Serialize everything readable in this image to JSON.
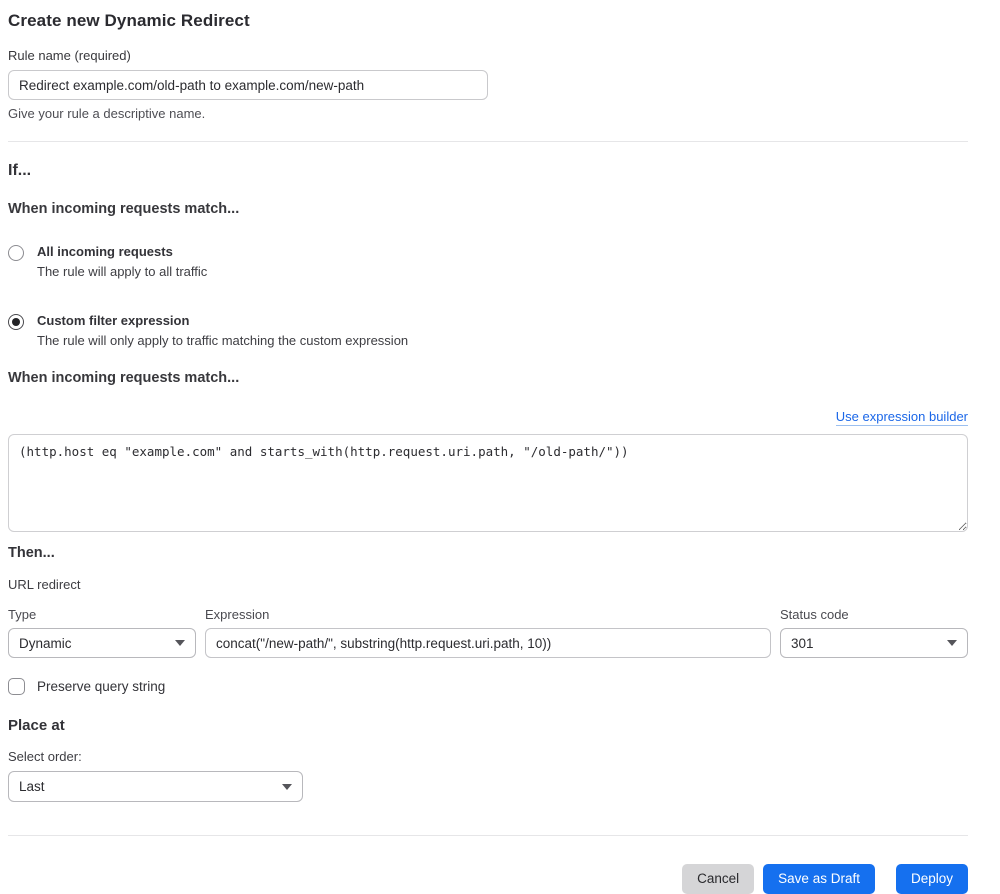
{
  "page": {
    "title": "Create new Dynamic Redirect"
  },
  "rule_name": {
    "label": "Rule name (required)",
    "value": "Redirect example.com/old-path to example.com/new-path",
    "help": "Give your rule a descriptive name."
  },
  "if_section": {
    "heading": "If...",
    "match_heading": "When incoming requests match...",
    "options": [
      {
        "label": "All incoming requests",
        "description": "The rule will apply to all traffic",
        "selected": false
      },
      {
        "label": "Custom filter expression",
        "description": "The rule will only apply to traffic matching the custom expression",
        "selected": true
      }
    ],
    "expression_heading": "When incoming requests match...",
    "builder_link_label": "Use expression builder",
    "expression_value": "(http.host eq \"example.com\" and starts_with(http.request.uri.path, \"/old-path/\"))"
  },
  "then_section": {
    "heading": "Then...",
    "action_label": "URL redirect",
    "type_field": {
      "label": "Type",
      "value": "Dynamic"
    },
    "expression_field": {
      "label": "Expression",
      "value": "concat(\"/new-path/\", substring(http.request.uri.path, 10))"
    },
    "status_field": {
      "label": "Status code",
      "value": "301"
    },
    "preserve_query_label": "Preserve query string",
    "preserve_query_checked": false
  },
  "place_at": {
    "heading": "Place at",
    "label": "Select order:",
    "value": "Last"
  },
  "footer": {
    "cancel_label": "Cancel",
    "save_draft_label": "Save as Draft",
    "deploy_label": "Deploy"
  },
  "colors": {
    "primary_blue": "#1570ef",
    "link_blue": "#1b67e8",
    "cancel_gray": "#d5d5d7"
  }
}
